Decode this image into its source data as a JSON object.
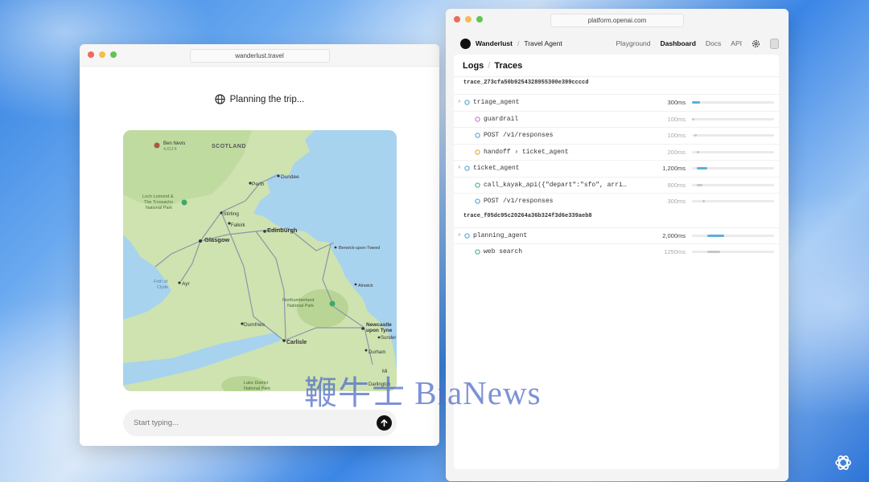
{
  "left_window": {
    "url": "wanderlust.travel",
    "status_text": "Planning the trip...",
    "chat": {
      "placeholder": "Start typing..."
    },
    "map": {
      "places": [
        {
          "label": "Ben Nevis",
          "id": "ben-nevis"
        },
        {
          "label": "4,413 ft",
          "id": "ben-nevis-height"
        },
        {
          "label": "SCOTLAND",
          "id": "scotland"
        },
        {
          "label": "Dundee",
          "id": "dundee"
        },
        {
          "label": "Perth",
          "id": "perth"
        },
        {
          "label": "Loch Lomond &",
          "id": "loch-lomond-1"
        },
        {
          "label": "The Trossachs",
          "id": "loch-lomond-2"
        },
        {
          "label": "National Park",
          "id": "loch-lomond-3"
        },
        {
          "label": "Stirling",
          "id": "stirling"
        },
        {
          "label": "Falkirk",
          "id": "falkirk"
        },
        {
          "label": "Edinburgh",
          "id": "edinburgh"
        },
        {
          "label": "Glasgow",
          "id": "glasgow"
        },
        {
          "label": "Berwick-upon-Tweed",
          "id": "berwick"
        },
        {
          "label": "Firth of",
          "id": "firth-1"
        },
        {
          "label": "Clyde",
          "id": "firth-2"
        },
        {
          "label": "Ayr",
          "id": "ayr"
        },
        {
          "label": "Alnwick",
          "id": "alnwick"
        },
        {
          "label": "Northumberland",
          "id": "northumberland-1"
        },
        {
          "label": "National Park",
          "id": "northumberland-2"
        },
        {
          "label": "Dumfries",
          "id": "dumfries"
        },
        {
          "label": "Newcastle",
          "id": "newcastle-1"
        },
        {
          "label": "upon Tyne",
          "id": "newcastle-2"
        },
        {
          "label": "Sunder",
          "id": "sunderland"
        },
        {
          "label": "Carlisle",
          "id": "carlisle"
        },
        {
          "label": "Durham",
          "id": "durham"
        },
        {
          "label": "Lake District",
          "id": "lake-district-1"
        },
        {
          "label": "National Park",
          "id": "lake-district-2"
        },
        {
          "label": "Darlington",
          "id": "darlington"
        },
        {
          "label": "Mi",
          "id": "middlesbrough"
        }
      ]
    }
  },
  "right_window": {
    "url": "platform.openai.com",
    "org": "Wanderlust",
    "separator": "/",
    "project": "Travel Agent",
    "nav": {
      "playground": "Playground",
      "dashboard": "Dashboard",
      "docs": "Docs",
      "api": "API"
    },
    "breadcrumb": {
      "logs": "Logs",
      "slash": "/",
      "traces": "Traces"
    },
    "trace_ids": [
      "trace_273cfa50b9254328955300e399ccccd",
      "trace_f05dc95c20264a36b324f3d6e339aeb8"
    ],
    "spans": [
      {
        "name": "triage_agent",
        "duration": "300ms",
        "level": 0,
        "expandable": true,
        "icon": "agent-icon",
        "fill_start": 0.0,
        "fill_len": 0.1,
        "color": "#5ab0d8"
      },
      {
        "name": "guardrail",
        "duration": "100ms",
        "level": 1,
        "expandable": false,
        "icon": "guardrail-icon",
        "fill_start": 0.0,
        "fill_len": 0.03,
        "color": "#c7c7c7"
      },
      {
        "name": "POST /v1/responses",
        "duration": "100ms",
        "level": 1,
        "expandable": false,
        "icon": "response-icon",
        "fill_start": 0.03,
        "fill_len": 0.03,
        "color": "#c7c7c7"
      },
      {
        "name": "handoff › ticket_agent",
        "duration": "200ms",
        "level": 1,
        "expandable": false,
        "icon": "handoff-icon",
        "fill_start": 0.06,
        "fill_len": 0.03,
        "color": "#c7c7c7"
      },
      {
        "name": "ticket_agent",
        "duration": "1,200ms",
        "level": 0,
        "expandable": true,
        "icon": "agent-icon",
        "fill_start": 0.06,
        "fill_len": 0.13,
        "color": "#5ab0d8"
      },
      {
        "name": "call_kayak_api({\"depart\":\"sfo\", arri…",
        "duration": "900ms",
        "level": 1,
        "expandable": false,
        "icon": "function-icon",
        "fill_start": 0.06,
        "fill_len": 0.07,
        "color": "#c7c7c7"
      },
      {
        "name": "POST /v1/responses",
        "duration": "300ms",
        "level": 1,
        "expandable": false,
        "icon": "response-icon",
        "fill_start": 0.13,
        "fill_len": 0.03,
        "color": "#c7c7c7"
      },
      {
        "name": "planning_agent",
        "duration": "2,000ms",
        "level": 0,
        "expandable": true,
        "icon": "agent-icon",
        "fill_start": 0.19,
        "fill_len": 0.2,
        "color": "#5ab0d8"
      },
      {
        "name": "web search",
        "duration": "1250ms",
        "level": 1,
        "expandable": false,
        "icon": "search-icon",
        "fill_start": 0.19,
        "fill_len": 0.15,
        "color": "#c7c7c7"
      }
    ]
  },
  "watermark": "鞭牛士 BiaNews",
  "colors": {
    "agent_fill": "#5ab0d8",
    "child_fill": "#c7c7c7",
    "map_land": "#cfe3b0",
    "map_water": "#a7d3ef"
  }
}
